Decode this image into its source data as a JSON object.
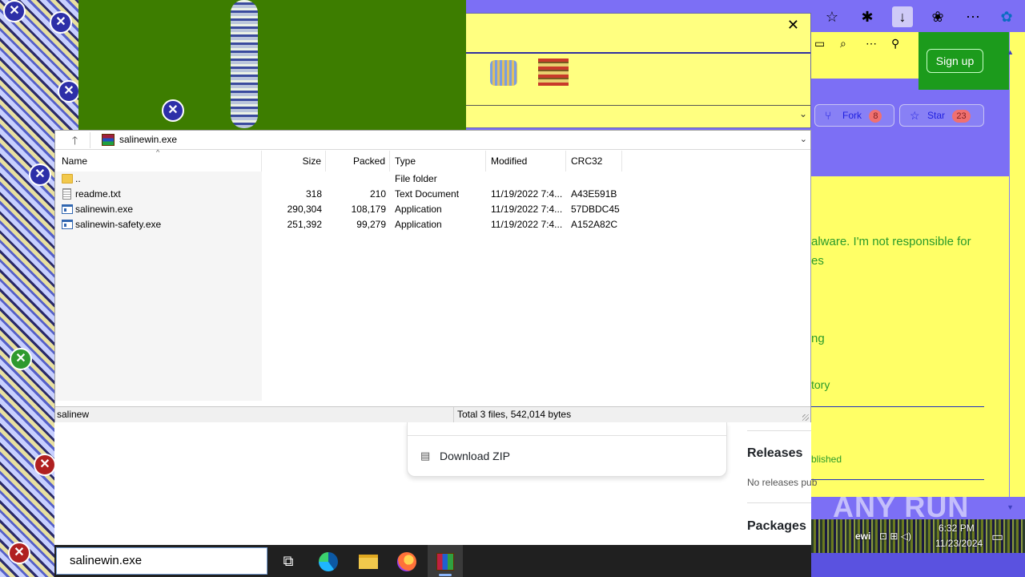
{
  "browser": {
    "sign_up": "Sign up",
    "fork_label": "Fork",
    "fork_count": "8",
    "star_label": "Star",
    "star_count": "23",
    "about_lines": [
      "alware. I'm not responsible for",
      "es"
    ],
    "link_ng": "ng",
    "link_tory": "tory",
    "releases_heading": "Releases",
    "releases_published": "blished",
    "no_releases": "No releases pub",
    "packages_heading": "Packages",
    "download_zip": "Download ZIP"
  },
  "winrar": {
    "path": "salinewin.exe",
    "columns": {
      "name": "Name",
      "size": "Size",
      "packed": "Packed",
      "type": "Type",
      "modified": "Modified",
      "crc": "CRC32"
    },
    "rows": [
      {
        "name": "..",
        "size": "",
        "packed": "",
        "type": "File folder",
        "modified": "",
        "crc": ""
      },
      {
        "name": "readme.txt",
        "size": "318",
        "packed": "210",
        "type": "Text Document",
        "modified": "11/19/2022 7:4...",
        "crc": "A43E591B"
      },
      {
        "name": "salinewin.exe",
        "size": "290,304",
        "packed": "108,179",
        "type": "Application",
        "modified": "11/19/2022 7:4...",
        "crc": "57DBDC45"
      },
      {
        "name": "salinewin-safety.exe",
        "size": "251,392",
        "packed": "99,279",
        "type": "Application",
        "modified": "11/19/2022 7:4...",
        "crc": "A152A82C"
      }
    ],
    "status_left": "salinew",
    "status_right": "Total 3 files, 542,014 bytes"
  },
  "taskbar": {
    "search_value": "salinewin.exe",
    "tray_app": "ewi",
    "tray_time": "6:32 PM",
    "tray_date": "11/23/2024"
  },
  "watermark": "ANY RUN"
}
